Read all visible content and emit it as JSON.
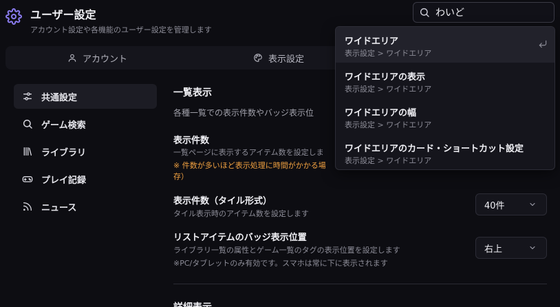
{
  "header": {
    "title": "ユーザー設定",
    "subtitle": "アカウント設定や各機能のユーザー設定を管理します",
    "icon": "gear-icon"
  },
  "search": {
    "value": "わいど",
    "icon": "search-icon"
  },
  "tabs": [
    {
      "label": "アカウント",
      "icon": "user-icon"
    },
    {
      "label": "表示設定",
      "icon": "palette-icon"
    }
  ],
  "sidebar": {
    "items": [
      {
        "label": "共通設定",
        "icon": "sliders-icon",
        "active": true
      },
      {
        "label": "ゲーム検索",
        "icon": "search-icon"
      },
      {
        "label": "ライブラリ",
        "icon": "library-icon"
      },
      {
        "label": "プレイ記録",
        "icon": "gamepad-icon"
      },
      {
        "label": "ニュース",
        "icon": "rss-icon"
      }
    ]
  },
  "main": {
    "section_title": "一覧表示",
    "section_desc": "各種一覧での表示件数やバッジ表示位",
    "settings": [
      {
        "title": "表示件数",
        "desc": "一覧ページに表示するアイテム数を設定しま",
        "warning_line1": "※ 件数が多いほど表示処理に時間がかかる場",
        "warning_line2": "存）"
      },
      {
        "title": "表示件数（タイル形式）",
        "desc": "タイル表示時のアイテム数を設定します",
        "value": "40件"
      },
      {
        "title": "リストアイテムのバッジ表示位置",
        "desc": "ライブラリ一覧の属性とゲーム一覧のタグの表示位置を設定します",
        "note": "※PC/タブレットのみ有効です。スマホは常に下に表示されます",
        "value": "右上"
      }
    ],
    "next_section_title": "詳細表示"
  },
  "suggestions": [
    {
      "title": "ワイドエリア",
      "path": "表示設定 > ワイドエリア",
      "highlighted": true
    },
    {
      "title": "ワイドエリアの表示",
      "path": "表示設定 > ワイドエリア"
    },
    {
      "title": "ワイドエリアの幅",
      "path": "表示設定 > ワイドエリア"
    },
    {
      "title": "ワイドエリアのカード・ショートカット設定",
      "path": "表示設定 > ワイドエリア"
    }
  ],
  "colors": {
    "accent": "#8b7cf0",
    "warning": "#f0a040",
    "background": "#0d0d12"
  }
}
